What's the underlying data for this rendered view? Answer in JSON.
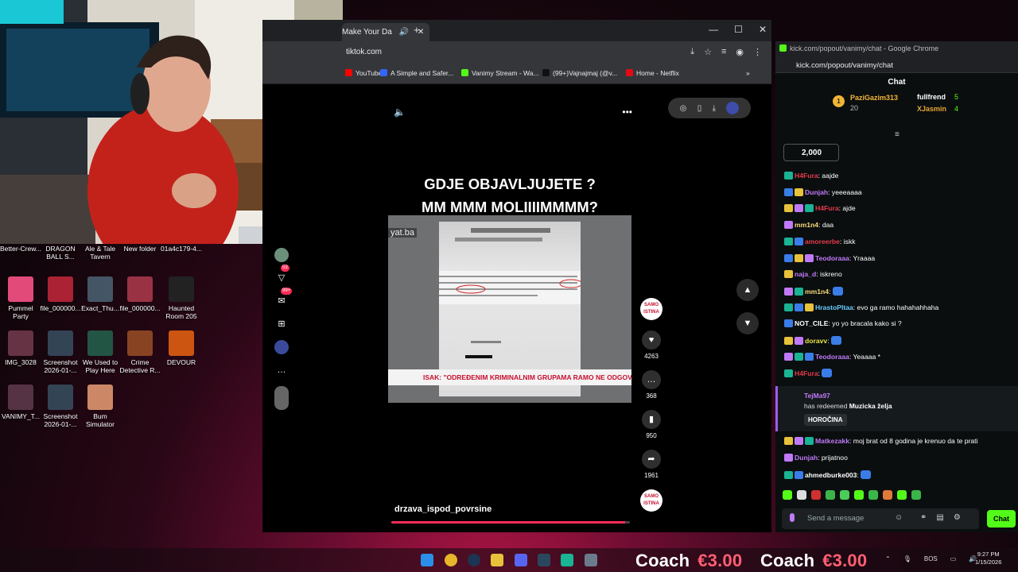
{
  "desktop": {
    "icons": [
      {
        "label": "Better-Crew...",
        "color": "#555555"
      },
      {
        "label": "DRAGON BALL S...",
        "color": "#446688"
      },
      {
        "label": "Ale & Tale Tavern",
        "color": "#886644"
      },
      {
        "label": "New folder",
        "color": "#c8a44a"
      },
      {
        "label": "01a4c179-4...",
        "color": "#777777"
      },
      {
        "label": "Pummel Party",
        "color": "#e24a7a"
      },
      {
        "label": "file_000000...",
        "color": "#aa2233"
      },
      {
        "label": "Exact_Thu...",
        "color": "#445566"
      },
      {
        "label": "file_000000...",
        "color": "#993344"
      },
      {
        "label": "Haunted Room 205",
        "color": "#222222"
      },
      {
        "label": "IMG_3028",
        "color": "#663344"
      },
      {
        "label": "Screenshot 2026-01-...",
        "color": "#334455"
      },
      {
        "label": "We Used to Play Here",
        "color": "#225544"
      },
      {
        "label": "Crime Detective R...",
        "color": "#884422"
      },
      {
        "label": "DEVOUR",
        "color": "#cc5511"
      },
      {
        "label": "VANIMY_T...",
        "color": "#553344"
      },
      {
        "label": "Screenshot 2026-01-...",
        "color": "#334455"
      },
      {
        "label": "Bum Simulator",
        "color": "#cc8866"
      }
    ]
  },
  "browser": {
    "tab_title": "Make Your Da",
    "url": "tiktok.com",
    "bookmarks": [
      {
        "label": "YouTube",
        "color": "#ff0000"
      },
      {
        "label": "A Simple and Safer...",
        "color": "#3366ff"
      },
      {
        "label": "Vanimy Stream - Wa...",
        "color": "#53fc18"
      },
      {
        "label": "(99+)Vajnajmaj (@v...",
        "color": "#111111"
      },
      {
        "label": "Home - Netflix",
        "color": "#e50914"
      }
    ],
    "window_controls": [
      "—",
      "☐",
      "✕"
    ]
  },
  "tiktok": {
    "sidebar_badges": {
      "inbox": "53",
      "notifications": "99+"
    },
    "caption": "GDJE OBJAVLJUJETE ?\nMM MMM MOLIIIIMMMM?",
    "watermark": "yat.ba",
    "banner_text": "ISAK: \"ODREĐENIM KRIMINALNIM GRUPAMA RAMO NE ODGOVARA\"",
    "counts": {
      "likes": "4263",
      "comments": "368",
      "saves": "950",
      "shares": "1961"
    },
    "creator_avatar_text": "SAMO ISTINA",
    "username": "drzava_ispod_povrsine",
    "progress": 0.98
  },
  "chat_window": {
    "title": "kick.com/popout/vanimy/chat - Google Chrome",
    "url": "kick.com/popout/vanimy/chat",
    "header": "Chat",
    "leaderboard": [
      {
        "rank": "1",
        "name": "PaziGazim313",
        "count": "20",
        "color": "#f2b534"
      },
      {
        "rank": "",
        "name": "fullfrend",
        "count": "5",
        "color": "#ffffff"
      },
      {
        "rank": "",
        "name": "XJasmin",
        "count": "4",
        "color": "#e7a43a"
      }
    ],
    "goal": "2,000",
    "messages": [
      {
        "user": "H4Fura",
        "text": "aajde",
        "color": "#e63a4a"
      },
      {
        "user": "Dunjah",
        "text": "yeeeaaaa",
        "color": "#c07af8"
      },
      {
        "user": "H4Fura",
        "text": "ajde",
        "color": "#e63a4a"
      },
      {
        "user": "mm1n4",
        "text": "daa",
        "color": "#f6d97b"
      },
      {
        "user": "amoreerbe",
        "text": "iskk",
        "color": "#e63a4a"
      },
      {
        "user": "Teodoraaa",
        "text": "Yraaaa",
        "color": "#c07af8"
      },
      {
        "user": "naja_d",
        "text": "iskreno",
        "color": "#c07af8"
      },
      {
        "user": "mm1n4",
        "text": "",
        "color": "#f6d97b"
      },
      {
        "user": "HrastoPltaa",
        "text": "evo ga ramo hahahahhaha",
        "color": "#66ccff"
      },
      {
        "user": "NOT_CILE",
        "text": "yo yo bracala kako si ?",
        "color": "#ffffff"
      },
      {
        "user": "doravv",
        "text": "",
        "color": "#e6e64a"
      },
      {
        "user": "Teodoraaa",
        "text": "Yeaaaa *",
        "color": "#c07af8"
      },
      {
        "user": "H4Fura",
        "text": "",
        "color": "#e63a4a"
      }
    ],
    "redeem": {
      "user": "TejMa97",
      "text": "has redeemed",
      "reward": "Muzicka želja",
      "detail": "HOROČINA"
    },
    "messages_after": [
      {
        "user": "Matkezakk",
        "text": "moj brat od 8 godina je krenuo da te prati",
        "color": "#c07af8"
      },
      {
        "user": "Dunjah",
        "text": "prijatnoo",
        "color": "#c07af8"
      },
      {
        "user": "ahmedburke003",
        "text": "",
        "color": "#ffffff"
      }
    ],
    "input_placeholder": "Send a message",
    "send_label": "Chat"
  },
  "overlay": {
    "coach_left": {
      "label": "Coach",
      "price": "€3.00"
    },
    "coach_right": {
      "label": "Coach",
      "price": "€3.00"
    }
  },
  "taskbar": {
    "lang": "BOS",
    "time": "9:27 PM",
    "date": "1/15/2026"
  }
}
